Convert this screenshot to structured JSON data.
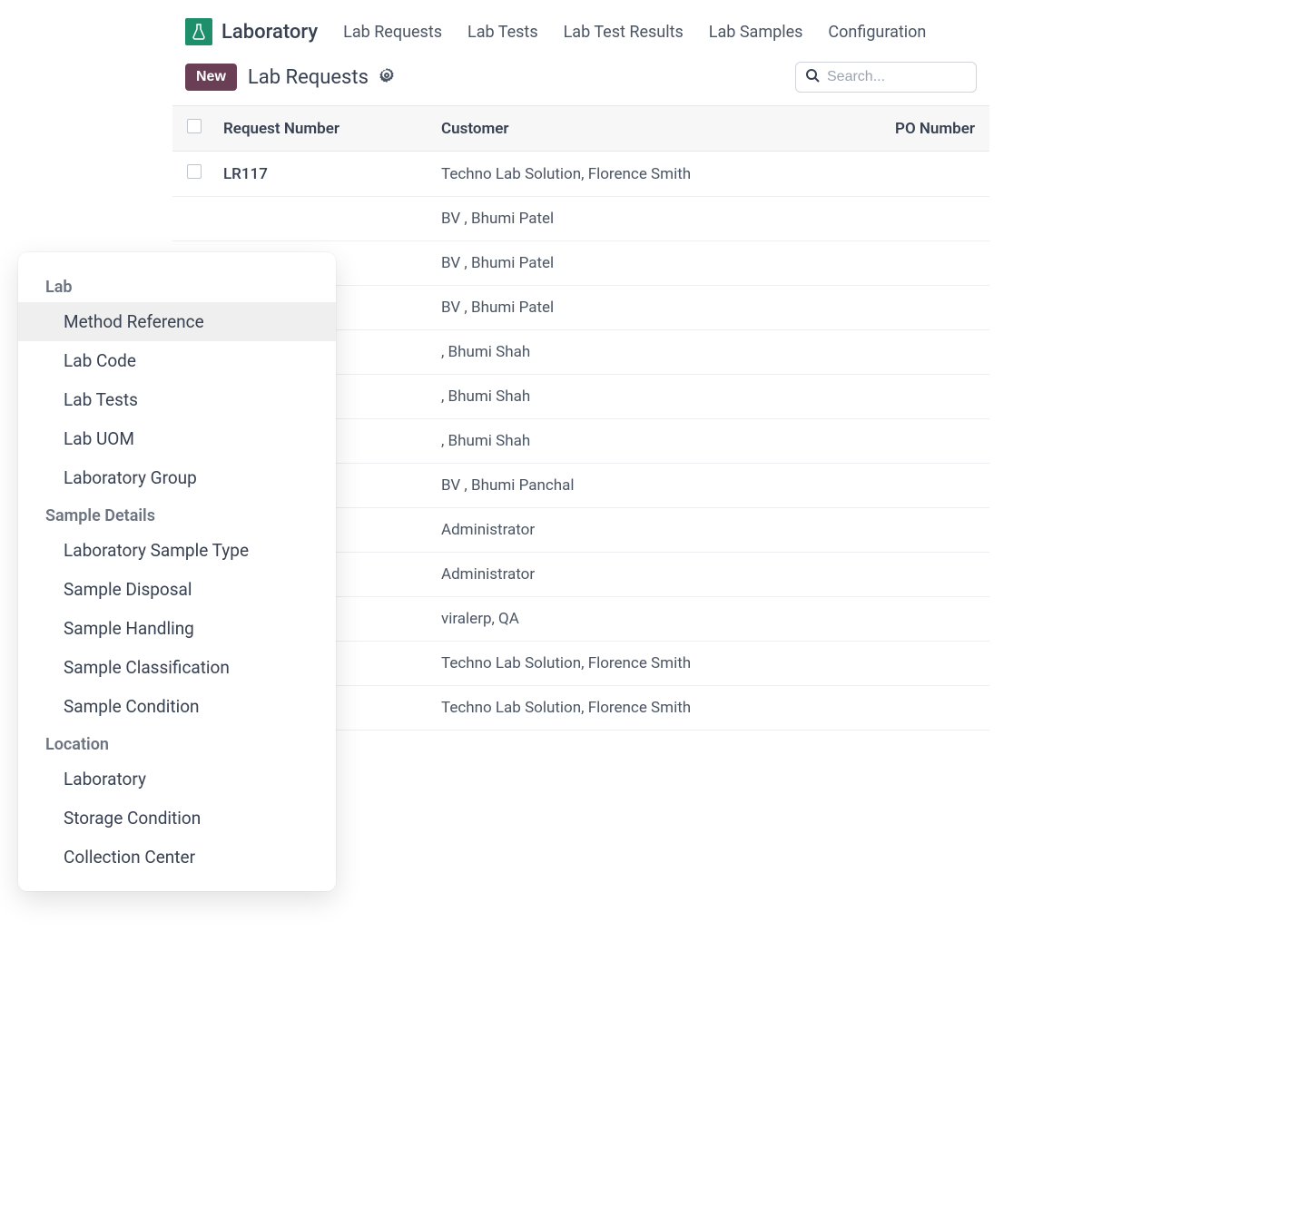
{
  "header": {
    "brand": "Laboratory",
    "nav": [
      "Lab Requests",
      "Lab Tests",
      "Lab Test Results",
      "Lab Samples",
      "Configuration"
    ]
  },
  "subheader": {
    "new_button": "New",
    "title": "Lab Requests"
  },
  "search": {
    "placeholder": "Search..."
  },
  "table": {
    "headers": {
      "request_number": "Request Number",
      "customer": "Customer",
      "po_number": "PO Number"
    },
    "rows": [
      {
        "request_number": "LR117",
        "customer": "Techno Lab Solution, Florence Smith"
      },
      {
        "request_number": "",
        "customer": "BV , Bhumi Patel"
      },
      {
        "request_number": "",
        "customer": "BV , Bhumi Patel"
      },
      {
        "request_number": "",
        "customer": "BV , Bhumi Patel"
      },
      {
        "request_number": "",
        "customer": ", Bhumi Shah"
      },
      {
        "request_number": "",
        "customer": ", Bhumi Shah"
      },
      {
        "request_number": "",
        "customer": ", Bhumi Shah"
      },
      {
        "request_number": "",
        "customer": "BV , Bhumi Panchal"
      },
      {
        "request_number": "",
        "customer": "Administrator"
      },
      {
        "request_number": "",
        "customer": "Administrator"
      },
      {
        "request_number": "",
        "customer": "viralerp, QA"
      },
      {
        "request_number": "",
        "customer": "Techno Lab Solution, Florence Smith"
      },
      {
        "request_number": "",
        "customer": "Techno Lab Solution, Florence Smith"
      }
    ]
  },
  "dropdown": {
    "sections": [
      {
        "title": "Lab",
        "items": [
          "Method Reference",
          "Lab Code",
          "Lab Tests",
          "Lab UOM",
          "Laboratory Group"
        ],
        "highlighted": 0
      },
      {
        "title": "Sample Details",
        "items": [
          "Laboratory Sample Type",
          "Sample Disposal",
          "Sample Handling",
          "Sample Classification",
          "Sample Condition"
        ]
      },
      {
        "title": "Location",
        "items": [
          "Laboratory",
          "Storage Condition",
          "Collection Center"
        ]
      }
    ]
  }
}
